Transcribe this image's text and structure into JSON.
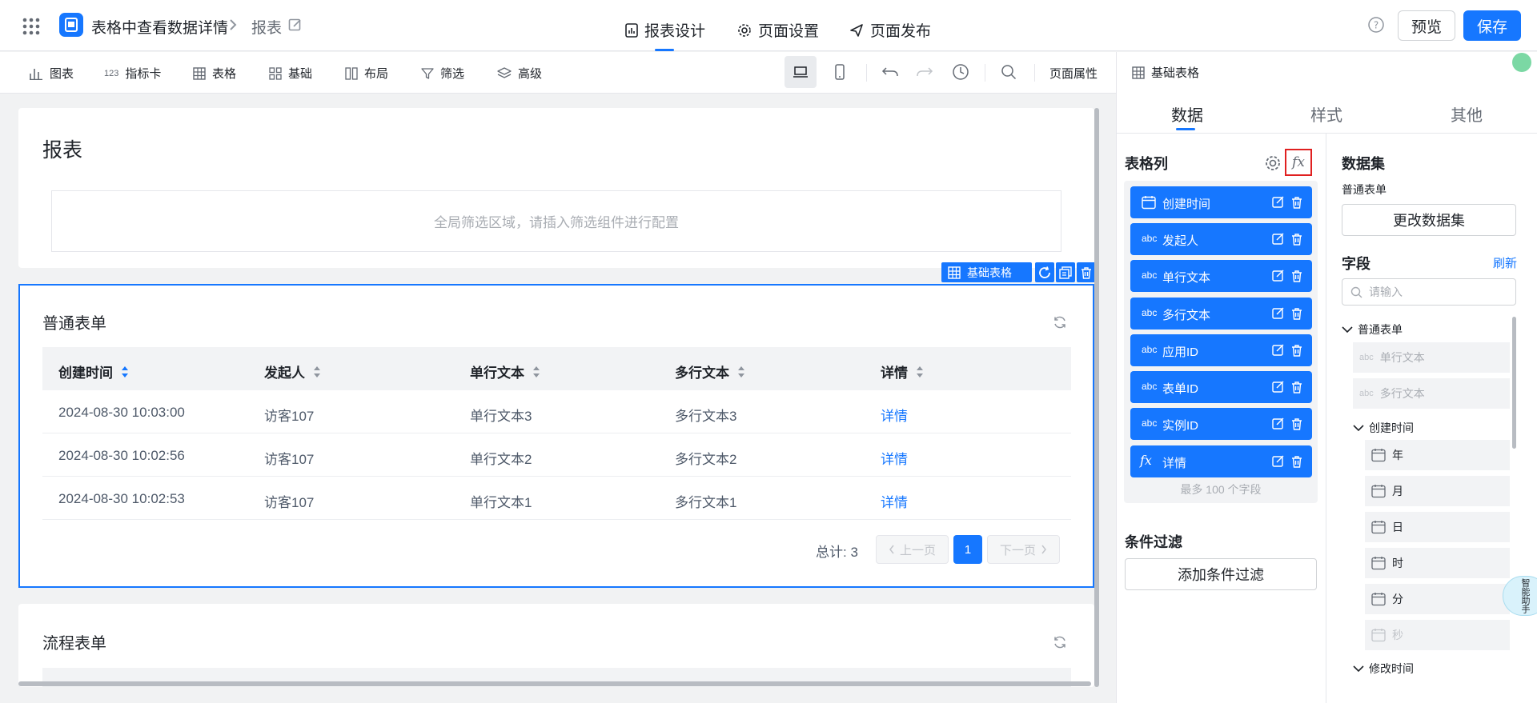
{
  "topbar": {
    "app_title": "表格中查看数据详情",
    "breadcrumb_page": "报表",
    "tabs": [
      {
        "label": "报表设计",
        "active": true
      },
      {
        "label": "页面设置",
        "active": false
      },
      {
        "label": "页面发布",
        "active": false
      }
    ],
    "preview_label": "预览",
    "save_label": "保存"
  },
  "toolbar": {
    "items": [
      {
        "label": "图表",
        "icon": "bar-chart-icon"
      },
      {
        "label": "指标卡",
        "icon": "number-icon"
      },
      {
        "label": "表格",
        "icon": "grid-icon"
      },
      {
        "label": "基础",
        "icon": "blocks-icon"
      },
      {
        "label": "布局",
        "icon": "columns-icon"
      },
      {
        "label": "筛选",
        "icon": "funnel-icon"
      },
      {
        "label": "高级",
        "icon": "layers-icon"
      }
    ],
    "page_props_label": "页面属性"
  },
  "canvas": {
    "report_title": "报表",
    "filter_placeholder": "全局筛选区域，请插入筛选组件进行配置",
    "selected_tag": "基础表格",
    "table1": {
      "title": "普通表单",
      "columns": [
        "创建时间",
        "发起人",
        "单行文本",
        "多行文本",
        "详情"
      ],
      "rows": [
        [
          "2024-08-30 10:03:00",
          "访客107",
          "单行文本3",
          "多行文本3",
          "详情"
        ],
        [
          "2024-08-30 10:02:56",
          "访客107",
          "单行文本2",
          "多行文本2",
          "详情"
        ],
        [
          "2024-08-30 10:02:53",
          "访客107",
          "单行文本1",
          "多行文本1",
          "详情"
        ]
      ],
      "total": "总计: 3",
      "prev": "上一页",
      "next": "下一页",
      "current_page": "1"
    },
    "table2": {
      "title": "流程表单"
    }
  },
  "panel": {
    "header": "基础表格",
    "tabs": [
      {
        "label": "数据",
        "active": true
      },
      {
        "label": "样式",
        "active": false
      },
      {
        "label": "其他",
        "active": false
      }
    ],
    "columns_title": "表格列",
    "columns": [
      {
        "type": "date",
        "label": "创建时间"
      },
      {
        "type": "abc",
        "label": "发起人"
      },
      {
        "type": "abc",
        "label": "单行文本"
      },
      {
        "type": "abc",
        "label": "多行文本"
      },
      {
        "type": "abc",
        "label": "应用ID"
      },
      {
        "type": "abc",
        "label": "表单ID"
      },
      {
        "type": "abc",
        "label": "实例ID"
      },
      {
        "type": "fx",
        "label": "详情"
      }
    ],
    "columns_max": "最多 100 个字段",
    "condition_title": "条件过滤",
    "add_condition": "添加条件过滤",
    "dataset_title": "数据集",
    "dataset_name": "普通表单",
    "change_dataset": "更改数据集",
    "fields_title": "字段",
    "refresh": "刷新",
    "search_placeholder": "请输入",
    "tree": {
      "root": "普通表单",
      "leaves": [
        "单行文本",
        "多行文本"
      ],
      "created_group": "创建时间",
      "created_parts": [
        "年",
        "月",
        "日",
        "时",
        "分",
        "秒"
      ],
      "modified_group": "修改时间"
    },
    "type_abc": "abc",
    "floater": "智能助手"
  },
  "colors": {
    "primary": "#1677ff",
    "highlight": "#e02020"
  }
}
